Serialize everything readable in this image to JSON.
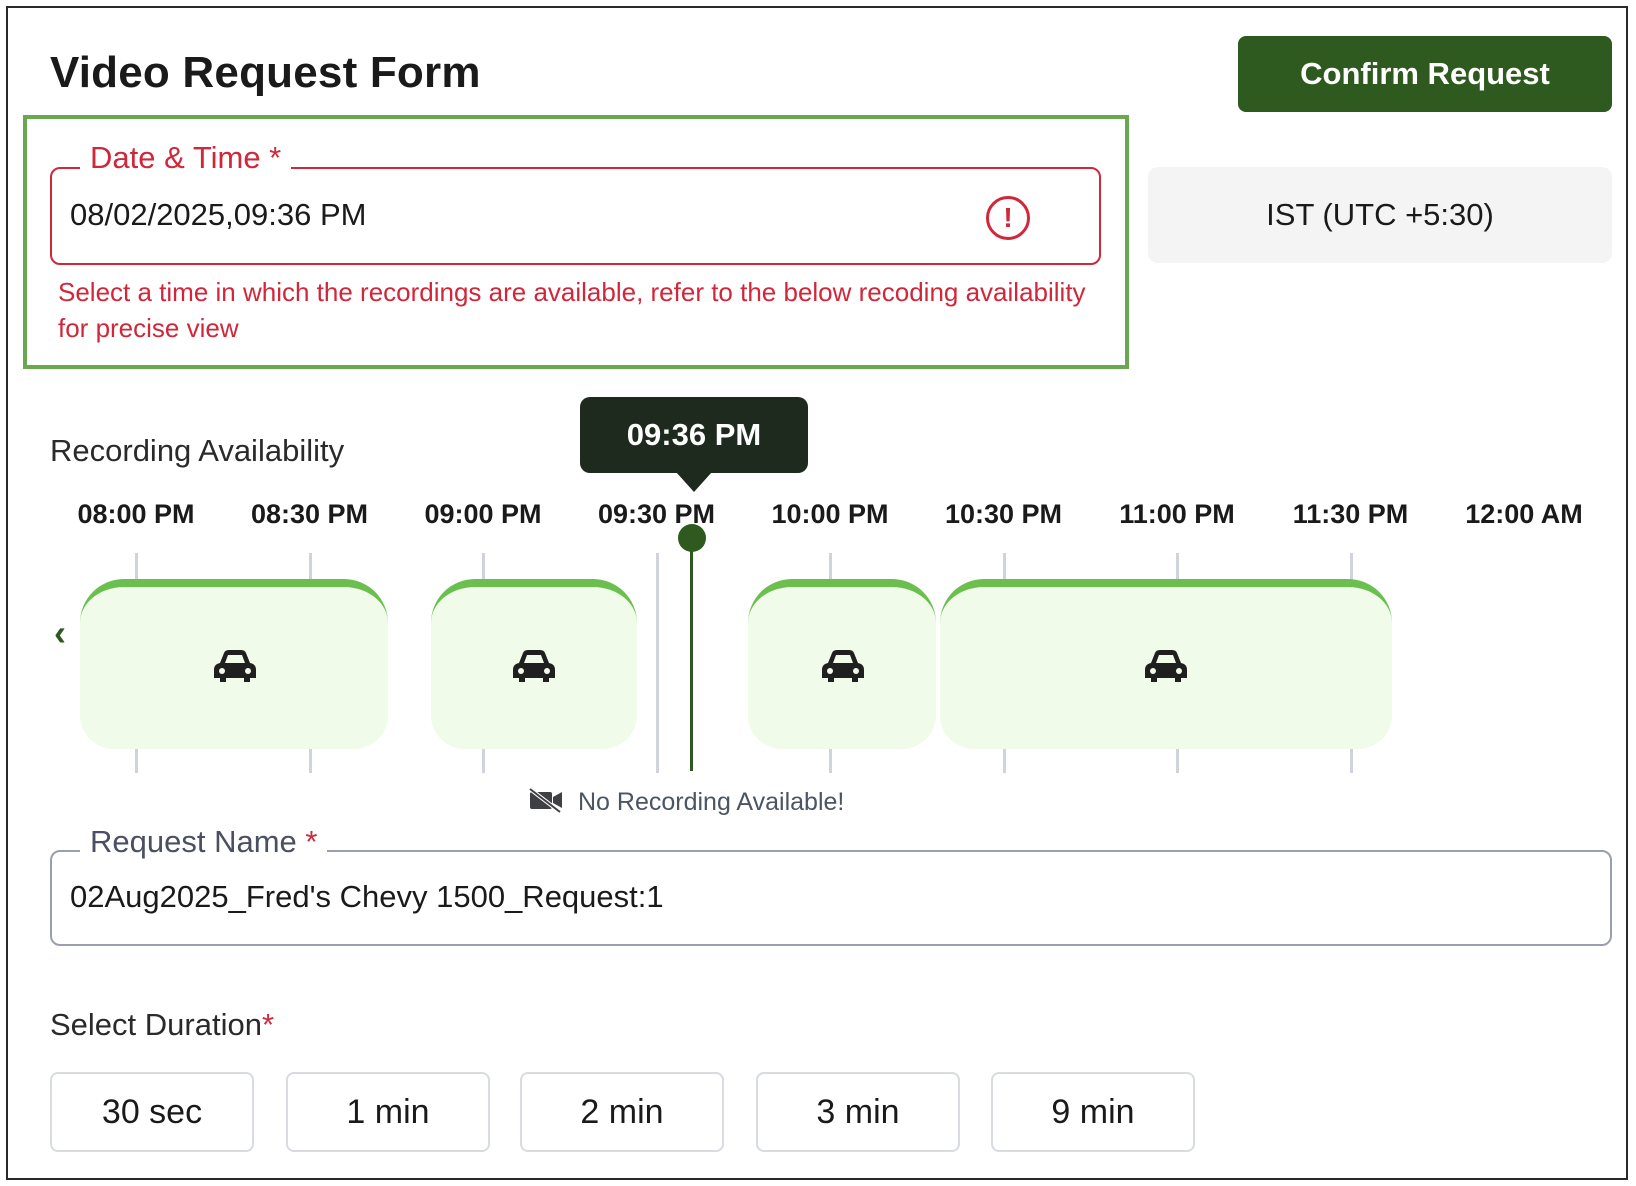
{
  "header": {
    "title": "Video Request Form",
    "confirm_label": "Confirm Request"
  },
  "datetime": {
    "label": "Date & Time *",
    "value": "08/02/2025,09:36 PM",
    "error_icon": "exclamation-circle-icon",
    "error_text": "Select a time in which the recordings are available, refer to the below recoding availability for precise view"
  },
  "timezone": {
    "value": "IST (UTC +5:30)"
  },
  "availability": {
    "label": "Recording Availability",
    "cursor_time": "09:36 PM",
    "ticks": [
      "08:00 PM",
      "08:30 PM",
      "09:00 PM",
      "09:30 PM",
      "10:00 PM",
      "10:30 PM",
      "11:00 PM",
      "11:30 PM",
      "12:00 AM"
    ],
    "prev_icon": "chevron-left-icon",
    "segment_icon": "car-icon",
    "no_recording_icon": "video-off-icon",
    "no_recording_text": "No Recording Available!"
  },
  "request_name": {
    "label": "Request Name",
    "required_mark": "*",
    "value": "02Aug2025_Fred's Chevy 1500_Request:1"
  },
  "duration": {
    "label": "Select Duration",
    "required_mark": "*",
    "options": [
      "30 sec",
      "1 min",
      "2 min",
      "3 min",
      "9 min"
    ]
  },
  "colors": {
    "accent_green": "#2f5a1f",
    "segment_fill": "#f1fbe9",
    "segment_border": "#6bbf4e",
    "error_red": "#d0273a",
    "highlight_green": "#6aa84f"
  }
}
